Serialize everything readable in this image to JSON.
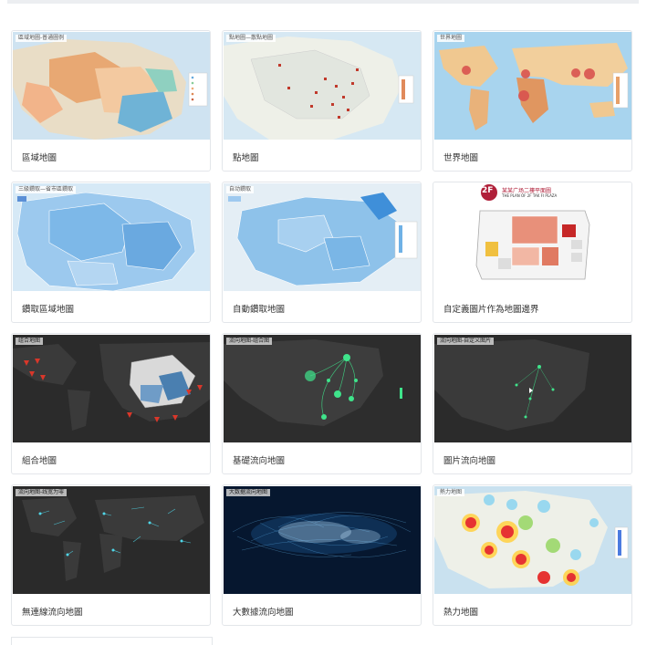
{
  "gallery": {
    "cards": [
      {
        "thumb_title": "區域地圖-普通圖例",
        "label": "區域地圖"
      },
      {
        "thumb_title": "點地圖—散點地圖",
        "label": "點地圖"
      },
      {
        "thumb_title": "世界地圖",
        "label": "世界地圖"
      },
      {
        "thumb_title": "三級鑽取—省市區鑽取",
        "label": "鑽取區域地圖"
      },
      {
        "thumb_title": "自动鑽取",
        "label": "自動鑽取地圖"
      },
      {
        "thumb_title": "某某广场二樓平面圖",
        "thumb_subtitle": "THE PLAN OF 2F TAK FI PLAZA",
        "badge": "2F",
        "label": "自定義圖片作為地圖邊界"
      },
      {
        "thumb_title": "组合地图",
        "label": "組合地圖"
      },
      {
        "thumb_title": "流向地图-组合图",
        "label": "基礎流向地圖"
      },
      {
        "thumb_title": "流向地图-自定义图片",
        "label": "圖片流向地圖"
      },
      {
        "thumb_title": "流向地图-线宽为零",
        "label": "無連線流向地圖"
      },
      {
        "thumb_title": "大数据流向地图",
        "label": "大數據流向地圖"
      },
      {
        "thumb_title": "熱力地图",
        "label": "熱力地圖"
      }
    ]
  },
  "colors": {
    "ocean_light": "#cfe3f1",
    "land_light": "#eef0e8",
    "heat_orange": "#e8a873",
    "blue_fill": "#8ec2ea",
    "dark_bg": "#2b2b2b",
    "flow_green": "#3fe48b",
    "flow_cyan": "#4fd6e8"
  }
}
